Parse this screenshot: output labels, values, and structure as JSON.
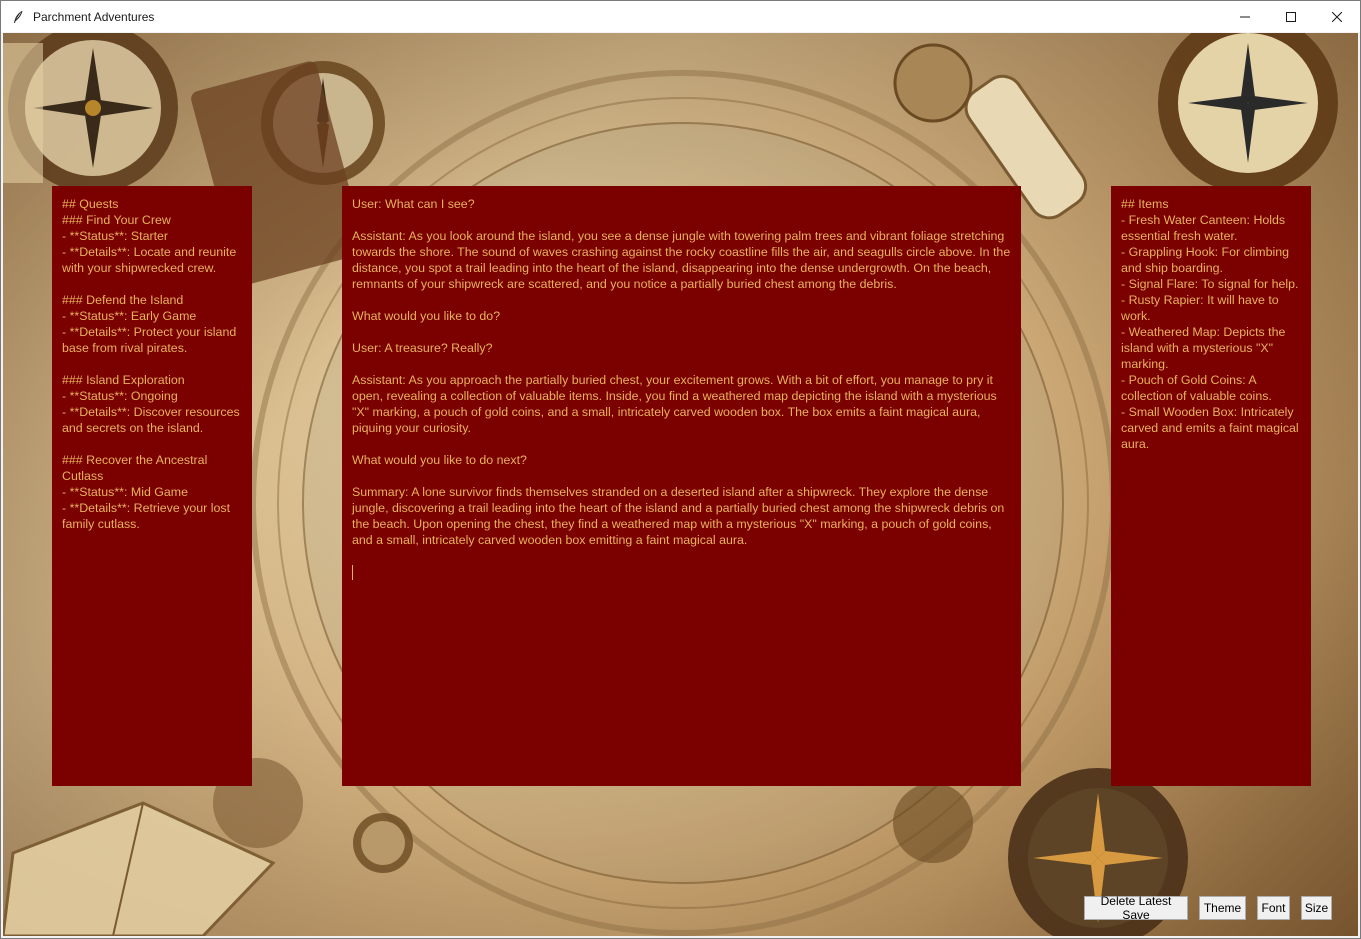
{
  "window": {
    "title": "Parchment Adventures"
  },
  "panels": {
    "quests": {
      "text": "## Quests\n### Find Your Crew\n- **Status**: Starter\n- **Details**: Locate and reunite with your shipwrecked crew.\n\n### Defend the Island\n- **Status**: Early Game\n- **Details**: Protect your island base from rival pirates.\n\n### Island Exploration\n- **Status**: Ongoing\n- **Details**: Discover resources and secrets on the island.\n\n### Recover the Ancestral Cutlass\n- **Status**: Mid Game\n- **Details**: Retrieve your lost family cutlass."
    },
    "story": {
      "text": "User: What can I see?\n\nAssistant: As you look around the island, you see a dense jungle with towering palm trees and vibrant foliage stretching towards the shore. The sound of waves crashing against the rocky coastline fills the air, and seagulls circle above. In the distance, you spot a trail leading into the heart of the island, disappearing into the dense undergrowth. On the beach, remnants of your shipwreck are scattered, and you notice a partially buried chest among the debris.\n\nWhat would you like to do?\n\nUser: A treasure? Really?\n\nAssistant: As you approach the partially buried chest, your excitement grows. With a bit of effort, you manage to pry it open, revealing a collection of valuable items. Inside, you find a weathered map depicting the island with a mysterious \"X\" marking, a pouch of gold coins, and a small, intricately carved wooden box. The box emits a faint magical aura, piquing your curiosity.\n\nWhat would you like to do next?\n\nSummary: A lone survivor finds themselves stranded on a deserted island after a shipwreck. They explore the dense jungle, discovering a trail leading into the heart of the island and a partially buried chest among the shipwreck debris on the beach. Upon opening the chest, they find a weathered map with a mysterious \"X\" marking, a pouch of gold coins, and a small, intricately carved wooden box emitting a faint magical aura.\n\n"
    },
    "items": {
      "text": "## Items\n- Fresh Water Canteen: Holds essential fresh water.\n- Grappling Hook: For climbing and ship boarding.\n- Signal Flare: To signal for help.\n- Rusty Rapier: It will have to work.\n- Weathered Map: Depicts the island with a mysterious \"X\" marking.\n- Pouch of Gold Coins: A collection of valuable coins.\n- Small Wooden Box: Intricately carved and emits a faint magical aura."
    }
  },
  "buttons": {
    "delete_save": "Delete Latest Save",
    "theme": "Theme",
    "font": "Font",
    "size": "Size"
  },
  "colors": {
    "panel_background": "#7b0000",
    "panel_text": "#e8b25e"
  }
}
